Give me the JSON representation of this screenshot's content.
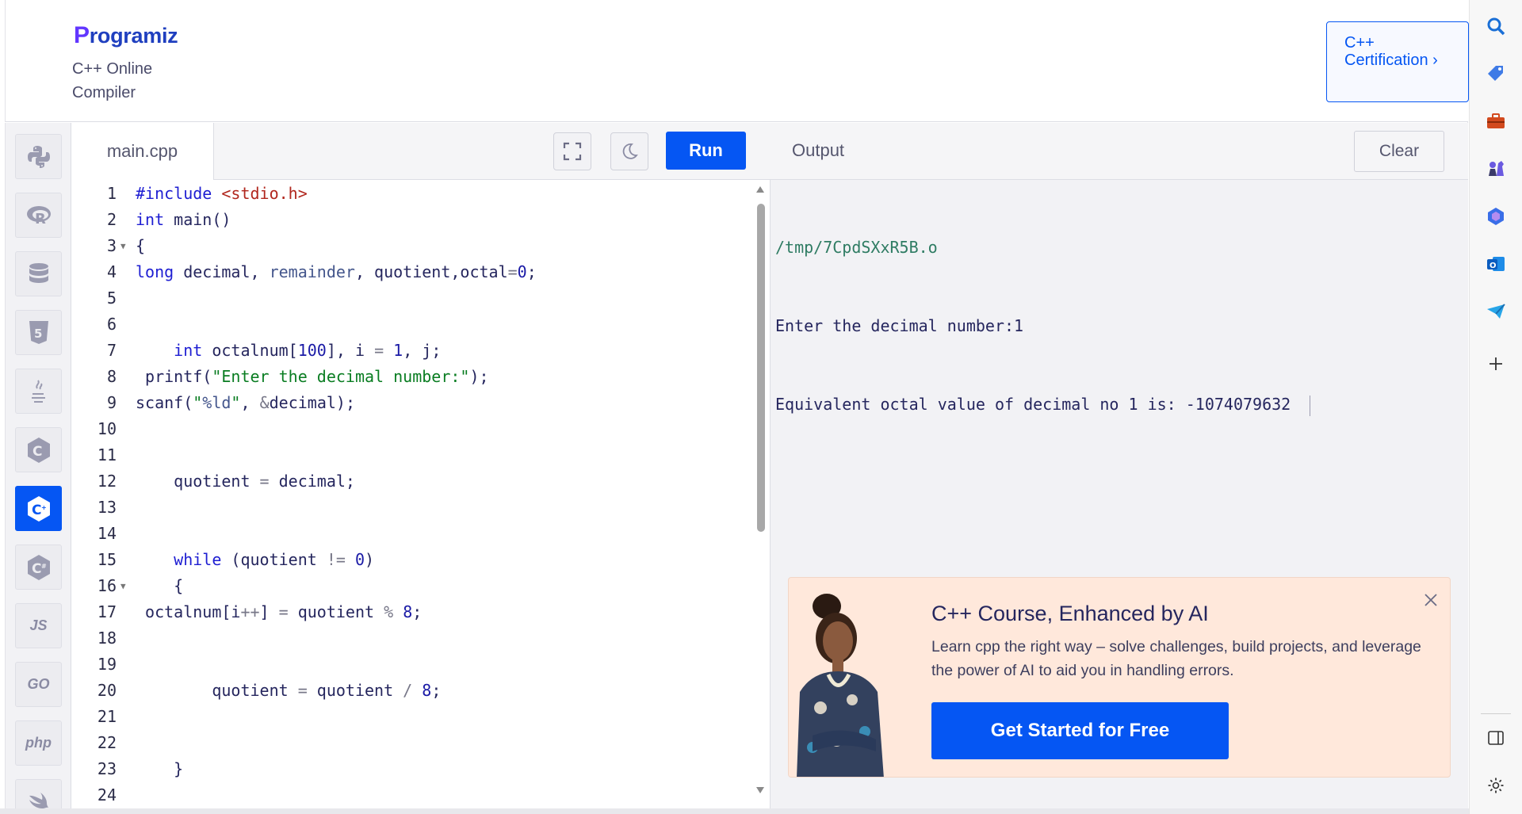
{
  "header": {
    "logo_text": "rogramiz",
    "logo_p": "P",
    "subtitle": "C++ Online Compiler",
    "cert_button": "C++ Certification ›"
  },
  "languages": [
    {
      "name": "python",
      "icon": "python-icon"
    },
    {
      "name": "r",
      "icon": "r-icon"
    },
    {
      "name": "sql",
      "icon": "database-icon"
    },
    {
      "name": "html",
      "icon": "html5-icon"
    },
    {
      "name": "java",
      "icon": "java-icon"
    },
    {
      "name": "c",
      "icon": "c-icon"
    },
    {
      "name": "cpp",
      "icon": "cpp-icon",
      "active": true
    },
    {
      "name": "csharp",
      "icon": "csharp-icon"
    },
    {
      "name": "js",
      "icon": "js-icon",
      "label": "JS"
    },
    {
      "name": "go",
      "icon": "go-icon",
      "label": "GO"
    },
    {
      "name": "php",
      "icon": "php-icon",
      "label": "php"
    },
    {
      "name": "swift",
      "icon": "swift-icon"
    }
  ],
  "editor": {
    "filename": "main.cpp",
    "run_label": "Run"
  },
  "code_lines": [
    {
      "n": "1",
      "text": "#include <stdio.h>"
    },
    {
      "n": "2",
      "text": "int main()"
    },
    {
      "n": "3",
      "text": "{",
      "fold": true
    },
    {
      "n": "4",
      "text": "long decimal, remainder, quotient,octal=0;"
    },
    {
      "n": "5",
      "text": ""
    },
    {
      "n": "6",
      "text": ""
    },
    {
      "n": "7",
      "text": "    int octalnum[100], i = 1, j;"
    },
    {
      "n": "8",
      "text": " printf(\"Enter the decimal number:\");"
    },
    {
      "n": "9",
      "text": "scanf(\"%ld\", &decimal);"
    },
    {
      "n": "10",
      "text": ""
    },
    {
      "n": "11",
      "text": ""
    },
    {
      "n": "12",
      "text": "    quotient = decimal;"
    },
    {
      "n": "13",
      "text": ""
    },
    {
      "n": "14",
      "text": ""
    },
    {
      "n": "15",
      "text": "    while (quotient != 0)"
    },
    {
      "n": "16",
      "text": "    {",
      "fold": true
    },
    {
      "n": "17",
      "text": " octalnum[i++] = quotient % 8;"
    },
    {
      "n": "18",
      "text": ""
    },
    {
      "n": "19",
      "text": ""
    },
    {
      "n": "20",
      "text": "        quotient = quotient / 8;"
    },
    {
      "n": "21",
      "text": ""
    },
    {
      "n": "22",
      "text": ""
    },
    {
      "n": "23",
      "text": "    }"
    },
    {
      "n": "24",
      "text": ""
    }
  ],
  "output": {
    "title": "Output",
    "clear_label": "Clear",
    "lines": [
      "/tmp/7CpdSXxR5B.o",
      "Enter the decimal number:1",
      "Equivalent octal value of decimal no 1 is: -1074079632"
    ]
  },
  "promo": {
    "title": "C++ Course, Enhanced by AI",
    "description": "Learn cpp the right way – solve challenges, build projects, and leverage the power of AI to aid you in handling errors.",
    "cta": "Get Started for Free"
  },
  "browser_sidebar": [
    "search-icon",
    "tag-icon",
    "toolbox-icon",
    "chess-icon",
    "copilot-icon",
    "outlook-icon",
    "send-icon",
    "plus-icon",
    "split-view-icon",
    "settings-icon"
  ],
  "colors": {
    "accent": "#0556f3",
    "promo_bg": "#ffe8db"
  }
}
